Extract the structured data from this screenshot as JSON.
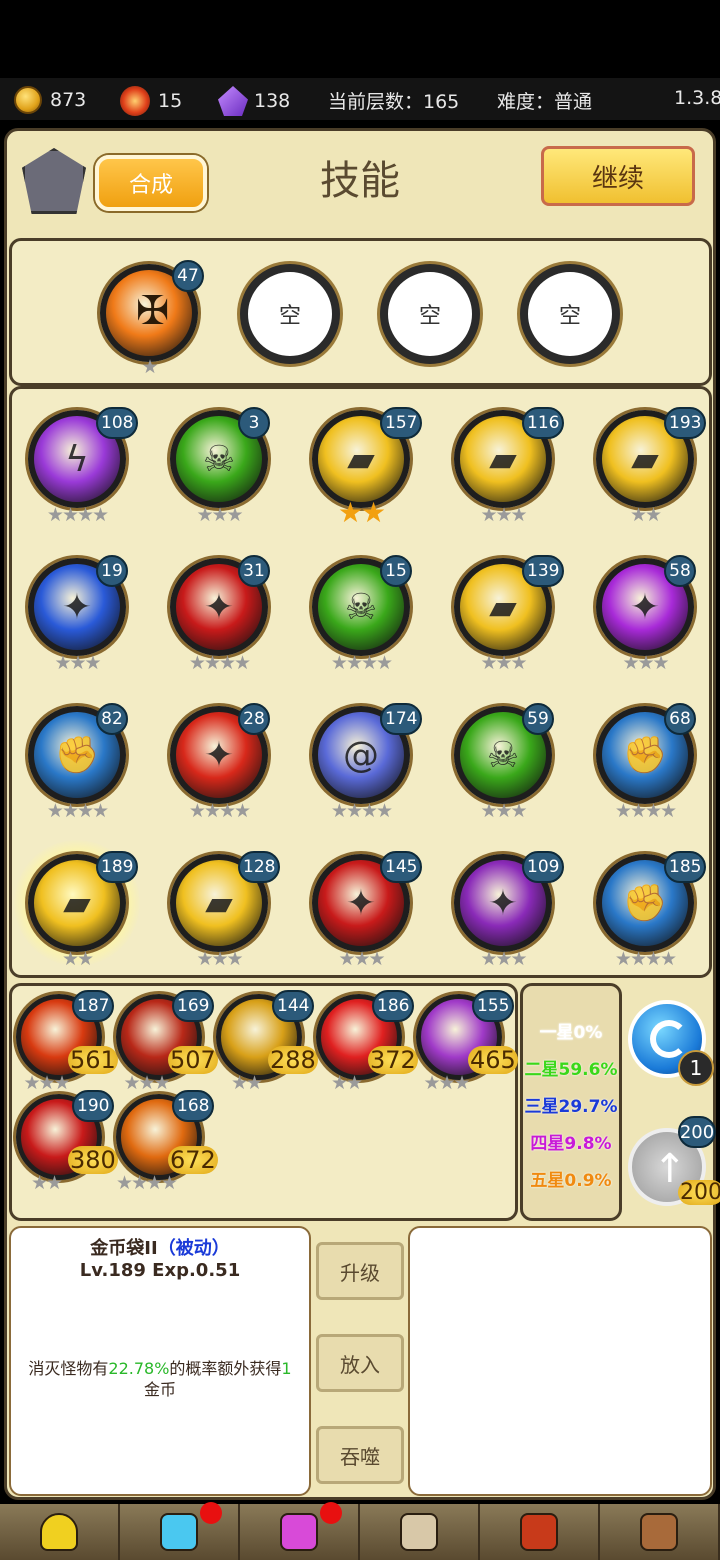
{
  "topbar": {
    "gold": "873",
    "ember": "15",
    "gem": "138",
    "floor": "当前层数：165",
    "difficulty": "难度：普通",
    "version": "1.3.8"
  },
  "header": {
    "merge": "合成",
    "title": "技能",
    "continue": "继续"
  },
  "equipped": [
    {
      "type": "skill",
      "level": "47",
      "icon": "holy-cross-icon",
      "bg": "#f07a18",
      "stars": "★"
    },
    {
      "type": "empty",
      "label": "空"
    },
    {
      "type": "empty",
      "label": "空"
    },
    {
      "type": "empty",
      "label": "空"
    }
  ],
  "skills": [
    {
      "level": "108",
      "icon": "lightning-icon",
      "bg": "#9a3ad8",
      "stars": "★★★★"
    },
    {
      "level": "3",
      "icon": "poison-skull-icon",
      "bg": "#3aa81a",
      "stars": "★★★"
    },
    {
      "level": "157",
      "icon": "gold-bag-icon",
      "bg": "#f0c020",
      "stars": "★★",
      "gold": true
    },
    {
      "level": "116",
      "icon": "gold-bag-icon",
      "bg": "#f0c020",
      "stars": "★★★"
    },
    {
      "level": "193",
      "icon": "gold-bag-icon",
      "bg": "#f0c020",
      "stars": "★★"
    },
    {
      "level": "19",
      "icon": "blue-wave-icon",
      "bg": "#2a5ad8",
      "stars": "★★★"
    },
    {
      "level": "31",
      "icon": "blood-slash-icon",
      "bg": "#c81a1a",
      "stars": "★★★★"
    },
    {
      "level": "15",
      "icon": "poison-skull-icon",
      "bg": "#3aa81a",
      "stars": "★★★★"
    },
    {
      "level": "139",
      "icon": "gold-bag-icon",
      "bg": "#f0c020",
      "stars": "★★★"
    },
    {
      "level": "58",
      "icon": "purple-rune-icon",
      "bg": "#a82ad8",
      "stars": "★★★"
    },
    {
      "level": "82",
      "icon": "frost-fist-icon",
      "bg": "#2a78c8",
      "stars": "★★★★"
    },
    {
      "level": "28",
      "icon": "claw-icon",
      "bg": "#d8281a",
      "stars": "★★★★"
    },
    {
      "level": "174",
      "icon": "vortex-icon",
      "bg": "#5a6ad8",
      "stars": "★★★★"
    },
    {
      "level": "59",
      "icon": "poison-skull-icon",
      "bg": "#3aa81a",
      "stars": "★★★"
    },
    {
      "level": "68",
      "icon": "frost-fist-icon",
      "bg": "#2a78c8",
      "stars": "★★★★"
    },
    {
      "level": "189",
      "icon": "gold-bag-icon",
      "bg": "#f0c020",
      "stars": "★★",
      "selected": true
    },
    {
      "level": "128",
      "icon": "gold-bag-icon",
      "bg": "#f0c020",
      "stars": "★★★"
    },
    {
      "level": "145",
      "icon": "blood-slash-icon",
      "bg": "#c81a1a",
      "stars": "★★★"
    },
    {
      "level": "109",
      "icon": "nebula-icon",
      "bg": "#8a2ab8",
      "stars": "★★★"
    },
    {
      "level": "185",
      "icon": "frost-fist-icon",
      "bg": "#2a78c8",
      "stars": "★★★★"
    }
  ],
  "shop": [
    {
      "level": "187",
      "cost": "561",
      "icon": "fire-burst-icon",
      "bg": "#d83a10",
      "stars": "★★★"
    },
    {
      "level": "169",
      "cost": "507",
      "icon": "flame-body-icon",
      "bg": "#b82818",
      "stars": "★★★"
    },
    {
      "level": "144",
      "cost": "288",
      "icon": "lava-icon",
      "bg": "#d8a018",
      "stars": "★★"
    },
    {
      "level": "186",
      "cost": "372",
      "icon": "blood-drop-icon",
      "bg": "#e02020",
      "stars": "★★"
    },
    {
      "level": "155",
      "cost": "465",
      "icon": "purple-orb-icon",
      "bg": "#a03ac8",
      "stars": "★★★"
    },
    {
      "level": "190",
      "cost": "380",
      "icon": "blood-slash-icon",
      "bg": "#c81a1a",
      "stars": "★★"
    },
    {
      "level": "168",
      "cost": "672",
      "icon": "fire-dancer-icon",
      "bg": "#e06a10",
      "stars": "★★★★"
    }
  ],
  "rates": [
    {
      "label": "一星0%",
      "color": "#ffffff"
    },
    {
      "label": "二星59.6%",
      "color": "#3ad81a"
    },
    {
      "label": "三星29.7%",
      "color": "#1a3ad8"
    },
    {
      "label": "四星9.8%",
      "color": "#c81ad8"
    },
    {
      "label": "五星0.9%",
      "color": "#f08a10"
    }
  ],
  "side": {
    "refresh_count": "1",
    "upgrade_level": "200",
    "upgrade_cost": "200"
  },
  "detail": {
    "name": "金币袋II",
    "tag": "（被动）",
    "lv": "Lv.189 Exp.0.51",
    "desc_a": "消灭怪物有",
    "desc_pct": "22.78%",
    "desc_b": "的概率额外获得",
    "desc_n": "1",
    "desc_c": "金币"
  },
  "actions": {
    "upgrade": "升级",
    "equip": "放入",
    "devour": "吞噬"
  },
  "nav": [
    {
      "icon": "hero-icon",
      "color": "#f0d020"
    },
    {
      "icon": "crystal-icon",
      "color": "#4ac8f0",
      "dot": true
    },
    {
      "icon": "rune-icon",
      "color": "#d84ad8",
      "dot": true
    },
    {
      "icon": "anvil-icon",
      "color": "#d8c8a8"
    },
    {
      "icon": "book-icon",
      "color": "#c83a1a"
    },
    {
      "icon": "gear-icon",
      "color": "#a86a3a"
    }
  ]
}
